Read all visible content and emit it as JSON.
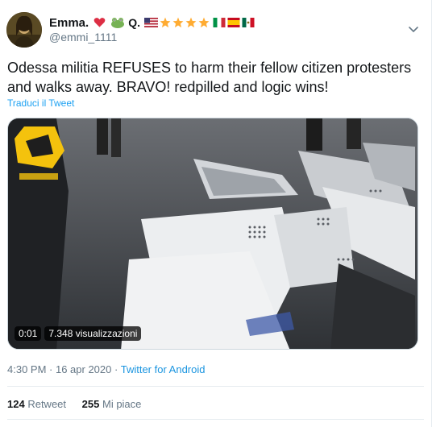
{
  "user": {
    "display_name": "Emma.",
    "badges_text": "Q.",
    "handle": "@emmi_1111"
  },
  "tweet": {
    "text": "Odessa militia REFUSES to harm their fellow citizen protesters  and walks away. BRAVO! redpilled and logic wins!",
    "translate_link": "Traduci il Tweet"
  },
  "video": {
    "elapsed": "0:01",
    "views": "7.348 visualizzazioni"
  },
  "meta": {
    "time": "4:30 PM",
    "separator": " · ",
    "date": "16 apr 2020",
    "source": "Twitter for Android"
  },
  "stats": {
    "retweets_count": "124",
    "retweets_label": "Retweet",
    "likes_count": "255",
    "likes_label": "Mi piace"
  },
  "colors": {
    "link": "#1da1f2",
    "secondary_text": "#657786",
    "primary_text": "#14171a"
  },
  "icons": [
    "heart-emoji",
    "frog-emoji",
    "us-flag",
    "star",
    "italy-flag",
    "spain-flag",
    "mexico-flag",
    "chevron-down-icon"
  ]
}
